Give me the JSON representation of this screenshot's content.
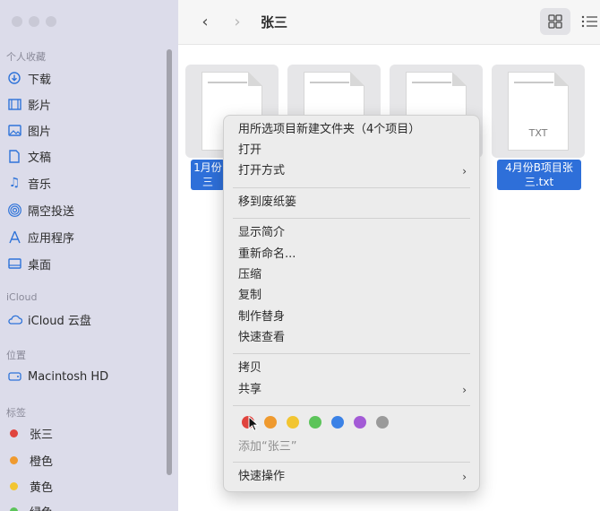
{
  "window": {
    "title": "张三"
  },
  "toolbar": {
    "back_icon": "chevron-left-icon",
    "forward_icon": "chevron-right-icon",
    "view_icon": "grid-icon",
    "list_icon": "list-icon"
  },
  "sidebar": {
    "favorites_title": "个人收藏",
    "favorites": [
      {
        "label": "下载",
        "icon": "download-icon"
      },
      {
        "label": "影片",
        "icon": "film-icon"
      },
      {
        "label": "图片",
        "icon": "image-icon"
      },
      {
        "label": "文稿",
        "icon": "document-icon"
      },
      {
        "label": "音乐",
        "icon": "music-icon"
      },
      {
        "label": "隔空投送",
        "icon": "airdrop-icon"
      },
      {
        "label": "应用程序",
        "icon": "apps-icon"
      },
      {
        "label": "桌面",
        "icon": "desktop-icon"
      }
    ],
    "icloud_title": "iCloud",
    "icloud": [
      {
        "label": "iCloud 云盘",
        "icon": "cloud-icon"
      }
    ],
    "locations_title": "位置",
    "locations": [
      {
        "label": "Macintosh HD",
        "icon": "disk-icon"
      }
    ],
    "tags_title": "标签",
    "tags": [
      {
        "label": "张三",
        "color": "#e0443e"
      },
      {
        "label": "橙色",
        "color": "#ef9a2f"
      },
      {
        "label": "黄色",
        "color": "#f2c531"
      },
      {
        "label": "绿色",
        "color": "#5cc45a"
      }
    ]
  },
  "files": [
    {
      "name_line1": "1月份",
      "name_line2": "三",
      "ext": ""
    },
    {
      "name_line1": "",
      "name_line2": "",
      "ext": ""
    },
    {
      "name_line1": "",
      "name_line2": "",
      "ext": ""
    },
    {
      "name_line1": "4月份B项目张",
      "name_line2": "三.txt",
      "ext": "TXT"
    }
  ],
  "context_menu": {
    "items": [
      {
        "label": "用所选项目新建文件夹（4个项目）"
      },
      {
        "label": "打开"
      },
      {
        "label": "打开方式",
        "submenu": true
      },
      {
        "label": "移到废纸篓"
      },
      {
        "label": "显示简介"
      },
      {
        "label": "重新命名..."
      },
      {
        "label": "压缩"
      },
      {
        "label": "复制"
      },
      {
        "label": "制作替身"
      },
      {
        "label": "快速查看"
      },
      {
        "label": "拷贝"
      },
      {
        "label": "共享",
        "submenu": true
      },
      {
        "label": "快速操作",
        "submenu": true
      }
    ],
    "tag_colors": [
      "#e0443e",
      "#ef9a2f",
      "#f2c531",
      "#5cc45a",
      "#3b82e6",
      "#a35bd6",
      "#9a9a9a"
    ],
    "add_tag_label": "添加“张三”"
  }
}
